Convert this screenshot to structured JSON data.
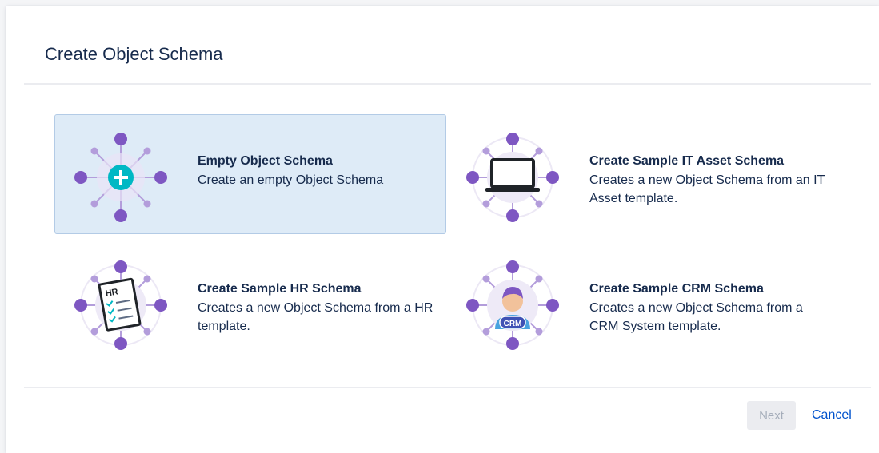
{
  "dialog": {
    "title": "Create Object Schema"
  },
  "options": [
    {
      "title": "Empty Object Schema",
      "description": "Create an empty Object Schema",
      "icon": "plus-node-icon",
      "selected": true
    },
    {
      "title": "Create Sample IT Asset Schema",
      "description": "Creates a new Object Schema from an IT Asset template.",
      "icon": "laptop-icon",
      "selected": false
    },
    {
      "title": "Create Sample HR Schema",
      "description": "Creates a new Object Schema from a HR template.",
      "icon": "hr-clipboard-icon",
      "icon_text": "HR",
      "selected": false
    },
    {
      "title": "Create Sample CRM Schema",
      "description": "Creates a new Object Schema from a CRM System template.",
      "icon": "crm-person-icon",
      "icon_text": "CRM",
      "selected": false
    }
  ],
  "footer": {
    "next_label": "Next",
    "cancel_label": "Cancel"
  },
  "colors": {
    "node_purple": "#7e57c2",
    "node_light": "#b39ddb",
    "teal": "#00b8c4",
    "selected_bg": "#deebf7",
    "link_blue": "#0052cc"
  }
}
